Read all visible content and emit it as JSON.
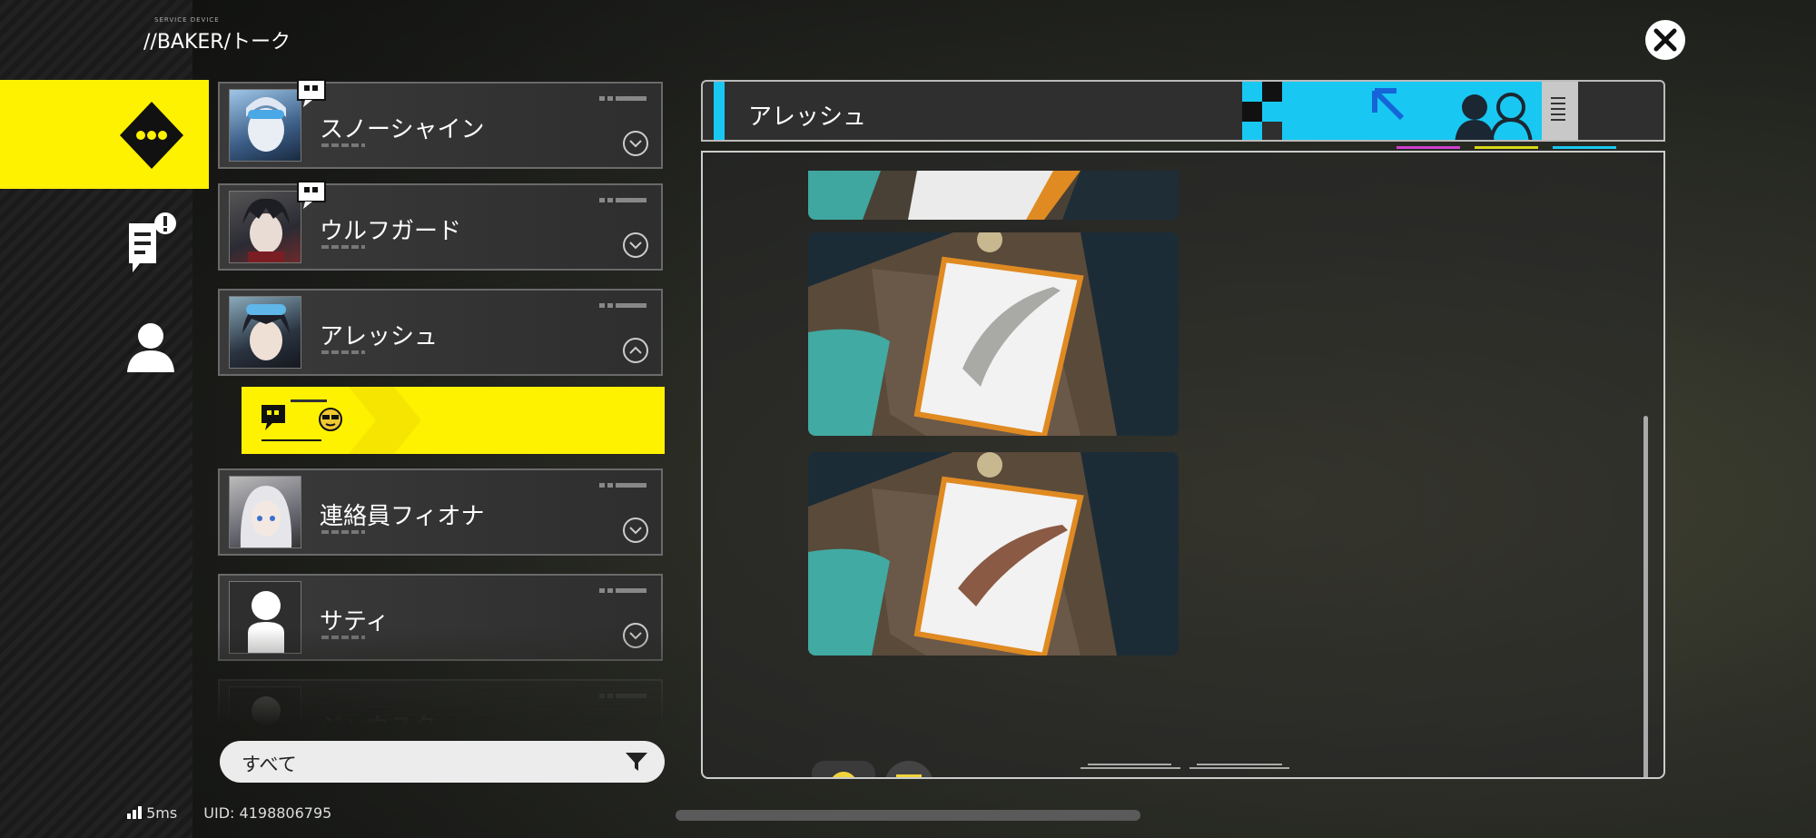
{
  "header": {
    "brand_small": "SERVICE DEVICE",
    "title": "//BAKER/トーク"
  },
  "nav": {
    "items": [
      "talk-icon",
      "mission-icon",
      "profile-icon"
    ],
    "active": 0
  },
  "contacts": [
    {
      "name": "スノーシャイン",
      "unread": true
    },
    {
      "name": "ウルフガード",
      "unread": true
    },
    {
      "name": "アレッシュ",
      "unread": false,
      "expanded": true
    },
    {
      "name": "連絡員フィオナ",
      "unread": false
    },
    {
      "name": "サティ",
      "unread": false
    },
    {
      "name": "ジャウスター",
      "unread": false
    }
  ],
  "filter": {
    "label": "すべて"
  },
  "footer": {
    "ping": "5ms",
    "uid": "UID: 4198806795"
  },
  "chat": {
    "title": "アレッシュ",
    "messages": [
      "fish-photo-cropped",
      "fish-photo-1",
      "fish-photo-2"
    ],
    "reactions": [
      "sunglasses-emoji",
      "smile-emoji"
    ]
  },
  "colors": {
    "accent": "#fff200",
    "cyan": "#18c8f2",
    "panel": "#2f2f2f"
  }
}
